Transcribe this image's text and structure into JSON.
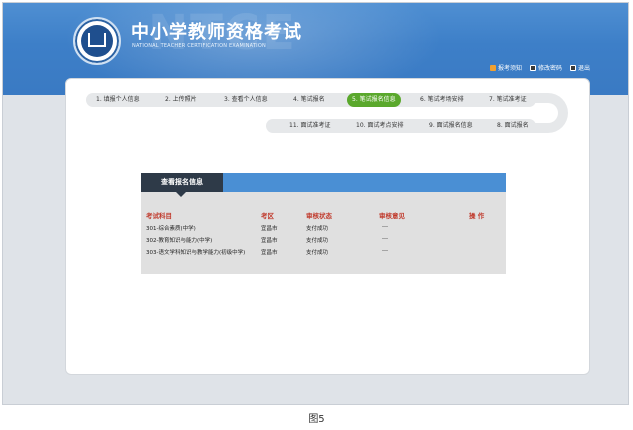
{
  "header": {
    "title_cn": "中小学教师资格考试",
    "title_en": "NATIONAL TEACHER CERTIFICATION EXAMINATION",
    "watermark": "NTCE",
    "links": [
      {
        "label": "报考须知",
        "icon": "notice-icon"
      },
      {
        "label": "修改密码",
        "icon": "password-icon"
      },
      {
        "label": "退出",
        "icon": "exit-icon"
      }
    ]
  },
  "steps_row1": [
    {
      "label": "1. 填报个人信息"
    },
    {
      "label": "2. 上传照片"
    },
    {
      "label": "3. 查看个人信息"
    },
    {
      "label": "4. 笔试报名"
    },
    {
      "label": "5. 笔试报名信息",
      "active": true
    },
    {
      "label": "6. 笔试考场安排"
    },
    {
      "label": "7. 笔试准考证"
    }
  ],
  "steps_row2": [
    {
      "label": "11. 面试准考证"
    },
    {
      "label": "10. 面试考点安排"
    },
    {
      "label": "9. 面试报名信息"
    },
    {
      "label": "8. 面试报名"
    }
  ],
  "info": {
    "tab_label": "查看报名信息",
    "columns": [
      "考试科目",
      "考区",
      "审核状态",
      "审核意见",
      "操 作"
    ],
    "rows": [
      {
        "subject": "301-综合素质(中学)",
        "area": "宜昌市",
        "status": "支付成功",
        "opinion": "---",
        "action": ""
      },
      {
        "subject": "302-教育知识与能力(中学)",
        "area": "宜昌市",
        "status": "支付成功",
        "opinion": "---",
        "action": ""
      },
      {
        "subject": "303-语文学科知识与教学能力(初级中学)",
        "area": "宜昌市",
        "status": "支付成功",
        "opinion": "---",
        "action": ""
      }
    ]
  },
  "caption": "图5",
  "colors": {
    "header_blue": "#3d7fc8",
    "active_step": "#5aa82c",
    "column_header": "#c0392b",
    "tab_dark": "#2e3a48",
    "tab_bar": "#4a8fd4"
  }
}
